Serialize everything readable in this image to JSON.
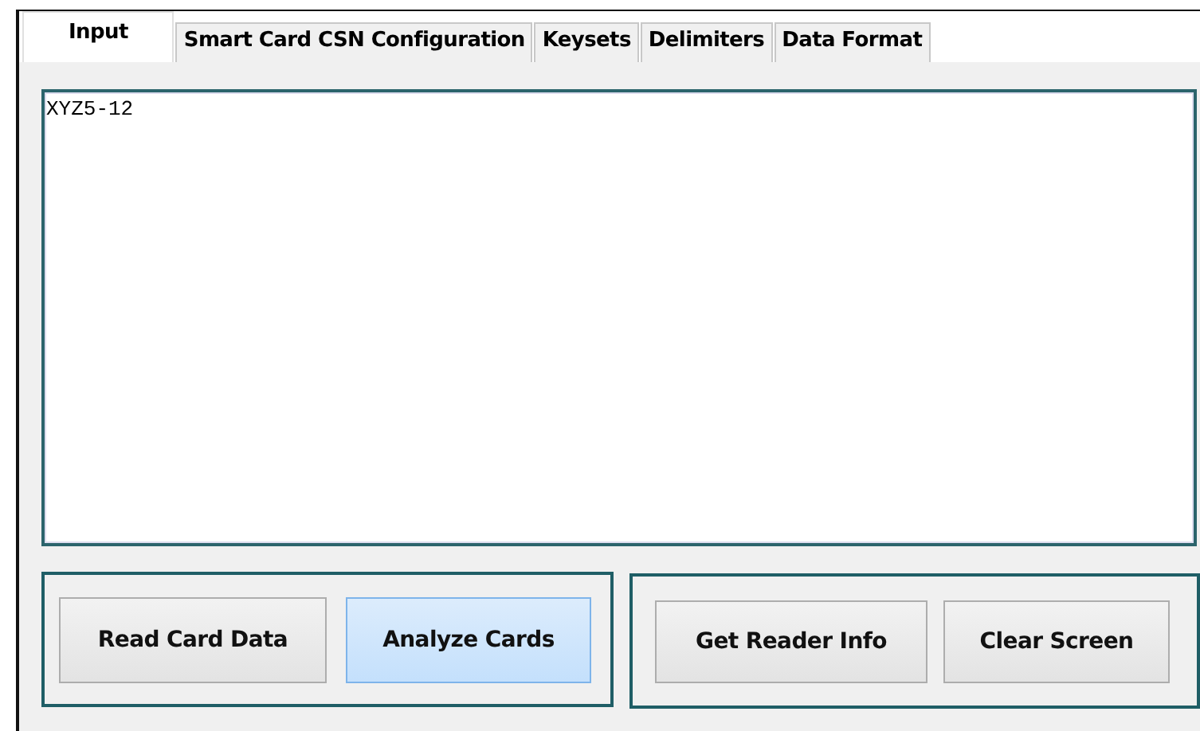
{
  "tabs": [
    {
      "label": "Input",
      "selected": true
    },
    {
      "label": "Smart Card CSN Configuration",
      "selected": false
    },
    {
      "label": "Keysets",
      "selected": false
    },
    {
      "label": "Delimiters",
      "selected": false
    },
    {
      "label": "Data Format",
      "selected": false
    }
  ],
  "input": {
    "value": "XYZ5-12\n"
  },
  "button_groups": [
    {
      "buttons": [
        {
          "label": "Read Card Data",
          "highlighted": false
        },
        {
          "label": "Analyze Cards",
          "highlighted": true
        }
      ]
    },
    {
      "buttons": [
        {
          "label": "Get Reader Info",
          "highlighted": false
        },
        {
          "label": "Clear Screen",
          "highlighted": false
        }
      ]
    }
  ]
}
